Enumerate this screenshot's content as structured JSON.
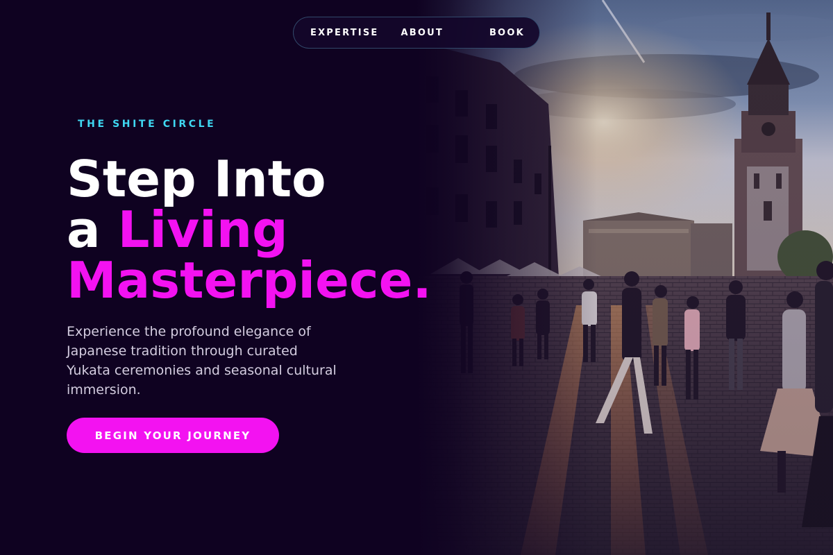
{
  "nav": {
    "items": [
      {
        "label": "EXPERTISE"
      },
      {
        "label": "ABOUT"
      },
      {
        "label": "BOOK"
      }
    ]
  },
  "hero": {
    "eyebrow": "THE SHITE CIRCLE",
    "headline_line1": "Step Into",
    "headline_line2_prefix": "a ",
    "headline_line2_accent": "Living",
    "headline_line3": "Masterpiece.",
    "description": "Experience the profound elegance of Japanese tradition through curated Yukata ceremonies and seasonal cultural immersion.",
    "cta_label": "BEGIN YOUR JOURNEY",
    "image_icon": "town-square-photo"
  },
  "colors": {
    "background": "#0f0221",
    "accent_magenta": "#f312f1",
    "accent_cyan": "#3fd8f2",
    "text_white": "#ffffff",
    "text_muted": "#d4cde0"
  }
}
